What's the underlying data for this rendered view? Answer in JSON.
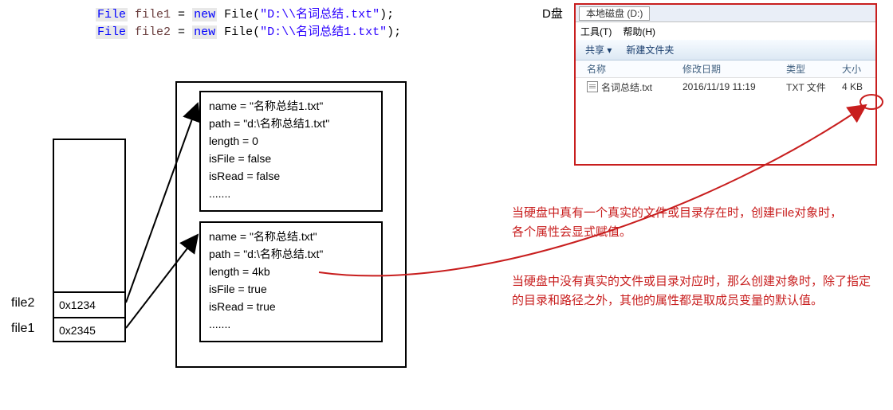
{
  "code": {
    "line1": {
      "kw1": "File",
      "var": "file1",
      "eq": " = ",
      "new": "new",
      "cls": " File",
      "open": "(",
      "str": "\"D:\\\\名词总结.txt\"",
      "close": ");"
    },
    "line2": {
      "kw1": "File",
      "var": "file2",
      "eq": " = ",
      "new": "new",
      "cls": " File",
      "open": "(",
      "str": "\"D:\\\\名词总结1.txt\"",
      "close": ");"
    }
  },
  "stack": {
    "label1": "file2",
    "label2": "file1",
    "cell1": "0x1234",
    "cell2": "0x2345"
  },
  "obj1": {
    "l1": "name = \"名称总结1.txt\"",
    "l2": "path = \"d:\\名称总结1.txt\"",
    "l3": "length = 0",
    "l4": "isFile = false",
    "l5": "isRead = false",
    "l6": "......."
  },
  "obj2": {
    "l1": "name = \"名称总结.txt\"",
    "l2": "path = \"d:\\名称总结.txt\"",
    "l3": "length = 4kb",
    "l4": "isFile = true",
    "l5": "isRead = true",
    "l6": "......."
  },
  "explorer": {
    "drive_label": "D盘",
    "address": "本地磁盘 (D:)",
    "menu1": "工具(T)",
    "menu2": "帮助(H)",
    "tool1": "共享 ▾",
    "tool2": "新建文件夹",
    "col1": "名称",
    "col2": "修改日期",
    "col3": "类型",
    "col4": "大小",
    "row": {
      "name": "名词总结.txt",
      "date": "2016/11/19 11:19",
      "type": "TXT 文件",
      "size": "4 KB"
    }
  },
  "notes": {
    "n1": "当硬盘中真有一个真实的文件或目录存在时，创建File对象时，各个属性会显式赋值。",
    "n2": "当硬盘中没有真实的文件或目录对应时，那么创建对象时，除了指定的目录和路径之外，其他的属性都是取成员变量的默认值。"
  }
}
